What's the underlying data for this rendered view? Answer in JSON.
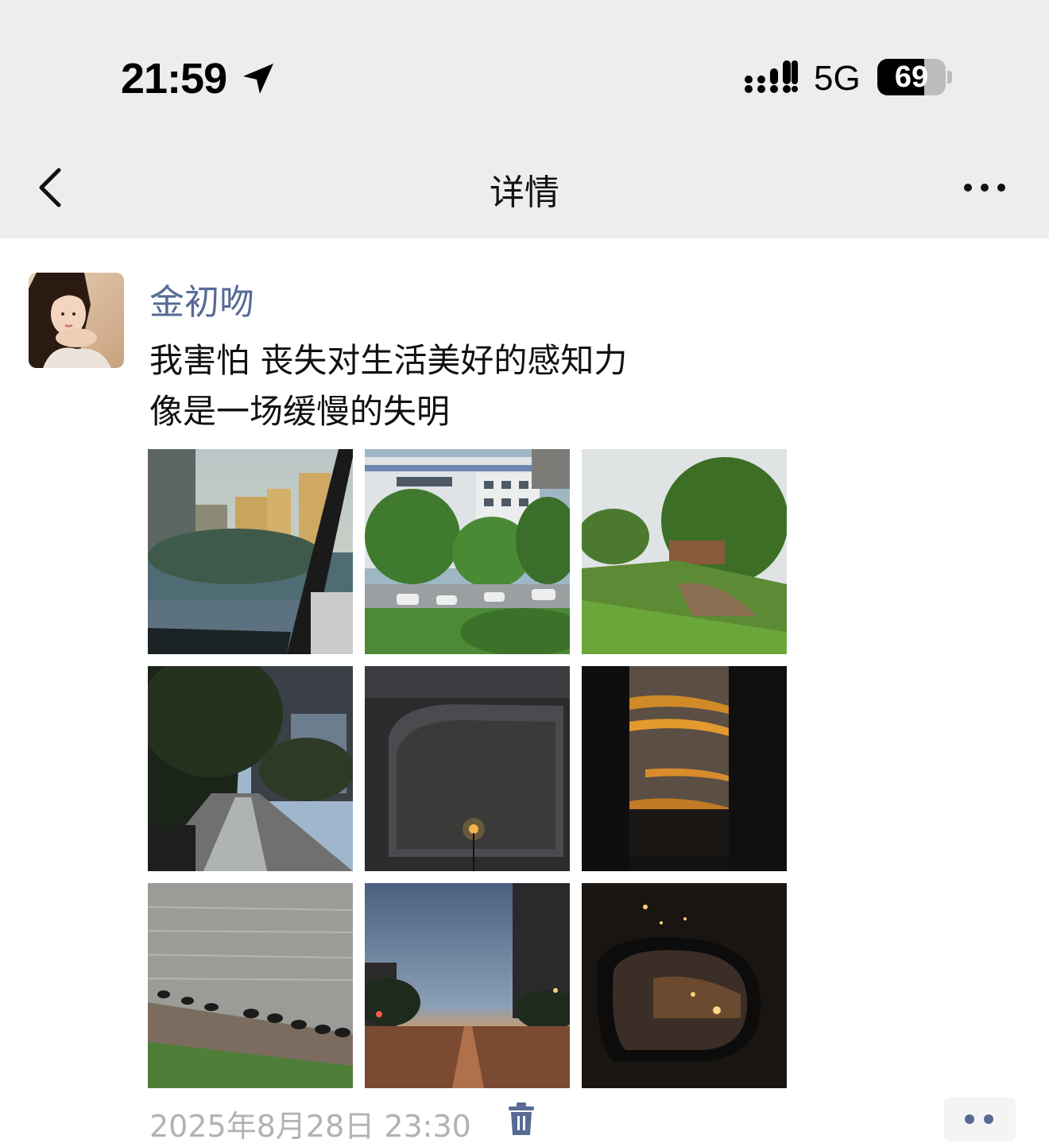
{
  "status_bar": {
    "time": "21:59",
    "network": "5G",
    "battery_percent": "69",
    "battery_level": 0.69,
    "location_icon": "location-arrow-icon",
    "signal_icon": "signal-bars-icon"
  },
  "nav": {
    "title": "详情",
    "back_icon": "chevron-left-icon",
    "more_icon": "ellipsis-icon"
  },
  "post": {
    "author": "金初吻",
    "text_lines": [
      "我害怕 丧失对生活美好的感知力",
      "像是一场缓慢的失明"
    ],
    "photos": [
      {
        "label": "rainy-window-city"
      },
      {
        "label": "building-trees-parking"
      },
      {
        "label": "tree-grass-hill"
      },
      {
        "label": "street-sidewalk-trees"
      },
      {
        "label": "car-interior-dusk"
      },
      {
        "label": "sunset-between-buildings"
      },
      {
        "label": "water-with-horses"
      },
      {
        "label": "city-street-dusk"
      },
      {
        "label": "side-mirror-night"
      }
    ],
    "timestamp": "2025年8月28日 23:30",
    "delete_icon": "trash-icon",
    "actions_icon": "two-dots-icon"
  },
  "colors": {
    "header_bg": "#ededed",
    "author_link": "#576b95",
    "timestamp": "#b2b2b2"
  }
}
